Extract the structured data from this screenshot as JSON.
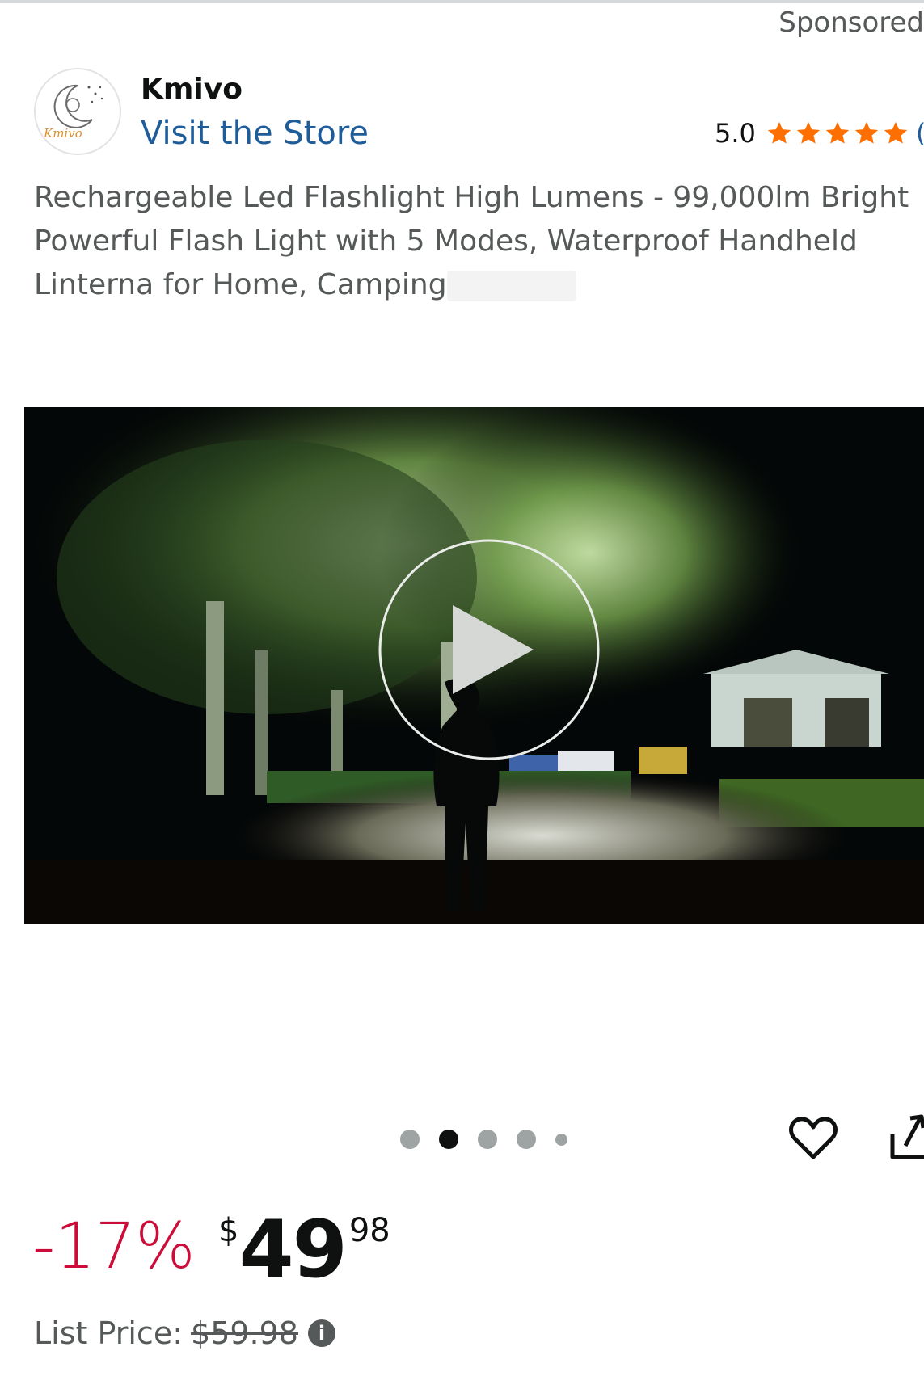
{
  "header": {
    "sponsored_label": "Sponsored"
  },
  "store": {
    "logo_text": "Kmivo",
    "brand_name": "Kmivo",
    "visit_label": "Visit the Store",
    "rating_value": "5.0",
    "rating_stars": 5,
    "rating_count_fragment": "("
  },
  "product": {
    "title": "Rechargeable Led Flashlight High Lumens - 99,000lm Bright Powerful Flash Light with 5 Modes, Waterproof Handheld Linterna for Home, Camping"
  },
  "media": {
    "play_icon": "play-icon",
    "carousel_dots": 5,
    "active_dot_index": 1
  },
  "pricing": {
    "discount": "-17%",
    "currency_symbol": "$",
    "price_whole": "49",
    "price_fraction": "98",
    "list_price_label": "List Price:",
    "list_price_value": "$59.98",
    "info_icon": "info-icon"
  },
  "colors": {
    "link": "#1f5d9a",
    "discount": "#cc0c39",
    "star": "#ff6f00"
  }
}
